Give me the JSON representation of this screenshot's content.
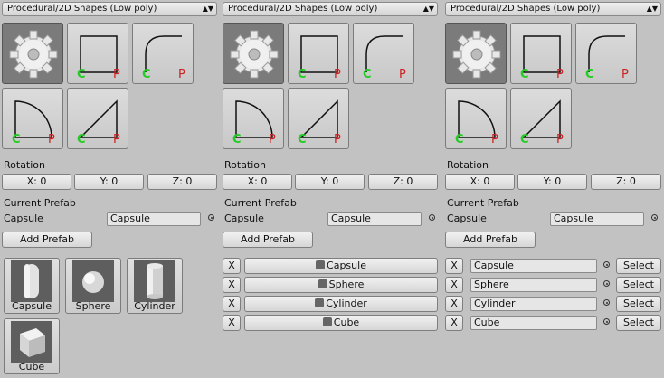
{
  "panels": [
    {
      "dropdown": "Procedural/2D Shapes (Low poly)",
      "rotation_label": "Rotation",
      "rotation": [
        "X: 0",
        "Y: 0",
        "Z: 0"
      ],
      "current_prefab_label": "Current Prefab",
      "prefab_name": "Capsule",
      "prefab_value": "Capsule",
      "add_prefab": "Add Prefab",
      "prefab_tiles": [
        "Capsule",
        "Sphere",
        "Cylinder",
        "Cube"
      ]
    },
    {
      "dropdown": "Procedural/2D Shapes (Low poly)",
      "rotation_label": "Rotation",
      "rotation": [
        "X: 0",
        "Y: 0",
        "Z: 0"
      ],
      "current_prefab_label": "Current Prefab",
      "prefab_name": "Capsule",
      "prefab_value": "Capsule",
      "add_prefab": "Add Prefab",
      "remove_label": "X",
      "prefab_rows": [
        "Capsule",
        "Sphere",
        "Cylinder",
        "Cube"
      ]
    },
    {
      "dropdown": "Procedural/2D Shapes (Low poly)",
      "rotation_label": "Rotation",
      "rotation": [
        "X: 0",
        "Y: 0",
        "Z: 0"
      ],
      "current_prefab_label": "Current Prefab",
      "prefab_name": "Capsule",
      "prefab_value": "Capsule",
      "add_prefab": "Add Prefab",
      "remove_label": "X",
      "select_label": "Select",
      "prefab_fields": [
        "Capsule",
        "Sphere",
        "Cylinder",
        "Cube"
      ]
    }
  ],
  "shape_tiles": [
    "gear-icon",
    "square-shape",
    "rounded-corner-shape",
    "quarter-circle-shape",
    "triangle-shape"
  ],
  "shape_markers": {
    "left": "C",
    "right": "P"
  },
  "colors": {
    "marker_c": "#22cc22",
    "marker_p": "#cc2222",
    "selected_tile": "#7b7b7b"
  }
}
